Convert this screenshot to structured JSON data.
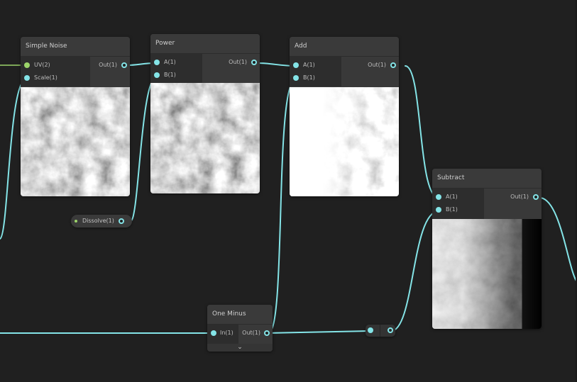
{
  "colors": {
    "background": "#202020",
    "wire": "#84e4e7",
    "uv_port": "#9cd46a",
    "node_body": "#393939"
  },
  "nodes": {
    "simple_noise": {
      "title": "Simple Noise",
      "inputs": [
        "UV(2)",
        "Scale(1)"
      ],
      "output": "Out(1)"
    },
    "power": {
      "title": "Power",
      "inputs": [
        "A(1)",
        "B(1)"
      ],
      "output": "Out(1)"
    },
    "add": {
      "title": "Add",
      "inputs": [
        "A(1)",
        "B(1)"
      ],
      "output": "Out(1)"
    },
    "subtract": {
      "title": "Subtract",
      "inputs": [
        "A(1)",
        "B(1)"
      ],
      "output": "Out(1)"
    },
    "one_minus": {
      "title": "One Minus",
      "inputs": [
        "In(1)"
      ],
      "output": "Out(1)",
      "expander_icon": "chevron-down-icon"
    }
  },
  "property": {
    "label": "Dissolve(1)"
  }
}
